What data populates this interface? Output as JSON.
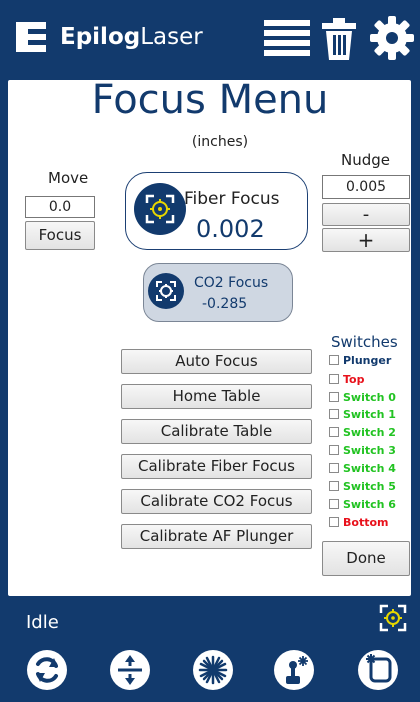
{
  "header": {
    "brand_bold": "Epilog",
    "brand_light": "Laser",
    "icons": [
      "menu-list-icon",
      "trash-icon",
      "gear-icon"
    ]
  },
  "title": "Focus Menu",
  "units": "(inches)",
  "move": {
    "label": "Move",
    "value": "0.0",
    "focus_button": "Focus"
  },
  "nudge": {
    "label": "Nudge",
    "value": "0.005",
    "minus": "-",
    "plus": "+"
  },
  "fiber_focus": {
    "label": "Fiber Focus",
    "value": "0.002"
  },
  "co2_focus": {
    "label": "CO2 Focus",
    "value": "-0.285"
  },
  "actions": [
    "Auto Focus",
    "Home Table",
    "Calibrate Table",
    "Calibrate Fiber Focus",
    "Calibrate CO2 Focus",
    "Calibrate AF Plunger"
  ],
  "switches": {
    "title": "Switches",
    "items": [
      {
        "label": "Plunger",
        "color": "#123a6d"
      },
      {
        "label": "Top",
        "color": "#e8111b"
      },
      {
        "label": "Switch 0",
        "color": "#22c322"
      },
      {
        "label": "Switch 1",
        "color": "#22c322"
      },
      {
        "label": "Switch 2",
        "color": "#22c322"
      },
      {
        "label": "Switch 3",
        "color": "#22c322"
      },
      {
        "label": "Switch 4",
        "color": "#22c322"
      },
      {
        "label": "Switch 5",
        "color": "#22c322"
      },
      {
        "label": "Switch 6",
        "color": "#22c322"
      },
      {
        "label": "Bottom",
        "color": "#e8111b"
      }
    ]
  },
  "done": "Done",
  "status": "Idle",
  "colors": {
    "brand": "#123a6d",
    "accent": "#e6d600"
  }
}
